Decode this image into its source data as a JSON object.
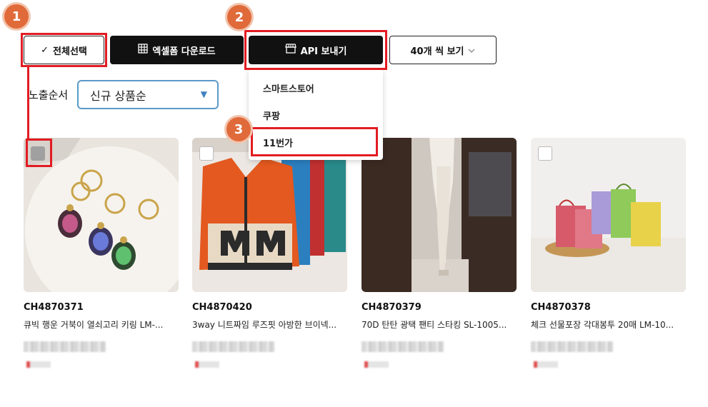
{
  "toolbar": {
    "select_all_label": "전체선택",
    "excel_label": "엑셀폼 다운로드",
    "api_label": "API 보내기",
    "per_page_label": "40개 씩 보기"
  },
  "sort": {
    "label": "노출순서",
    "selected": "신규 상품순"
  },
  "api_menu": {
    "items": [
      "스마트스토어",
      "쿠팡",
      "11번가"
    ]
  },
  "annotations": {
    "step1": "1",
    "step2": "2",
    "step3": "3"
  },
  "products": [
    {
      "code": "CH4870371",
      "title": "큐빅 행운 거북이 열쇠고리 키링 LM-..."
    },
    {
      "code": "CH4870420",
      "title": "3way 니트짜임 루즈핏 아방한 브이넥..."
    },
    {
      "code": "CH4870379",
      "title": "70D 탄탄 광택 팬티 스타킹 SL-1005..."
    },
    {
      "code": "CH4870378",
      "title": "체크 선물포장 각대봉투 20매 LM-10..."
    }
  ],
  "colors": {
    "highlight": "#e21c23",
    "badge": "#e06a3a",
    "select_border": "#5a9ac9"
  }
}
